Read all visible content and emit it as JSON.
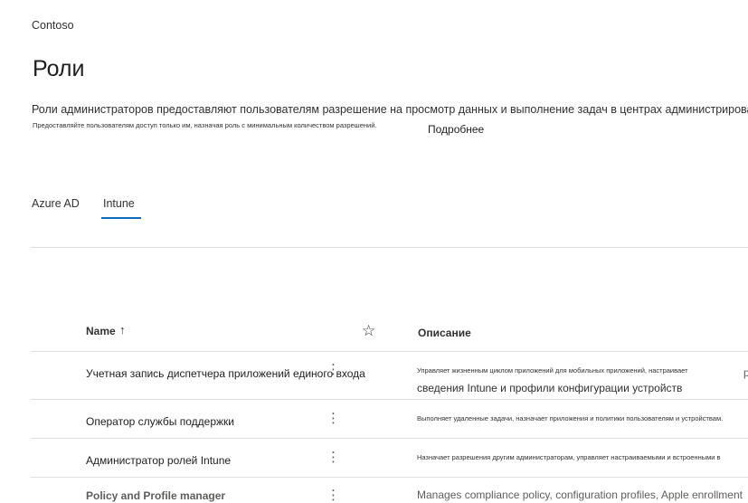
{
  "org_name": "Contoso",
  "page_title": "Роли",
  "description": "Роли администраторов предоставляют пользователям разрешение на просмотр данных и выполнение задач в центрах администрирования.",
  "hint": "Предоставляйте пользователям доступ только им, назначая роль с минимальным количеством разрешений.",
  "learn_more": "Подробнее",
  "tabs": [
    {
      "label": "Azure AD",
      "selected": false
    },
    {
      "label": "Intune",
      "selected": true
    }
  ],
  "table": {
    "col_name": "Name",
    "sort_icon": "↑",
    "favorite_icon": "☆",
    "col_description": "Описание",
    "more_icon": "⋮",
    "rows": [
      {
        "name": "Учетная запись диспетчера приложений единого входа",
        "description_line1": "Управляет жизненным циклом приложений для мобильных приложений, настраивает",
        "description_line2": "сведения Intune и профили конфигурации устройств",
        "overflow": "р"
      },
      {
        "name": "Оператор службы поддержки",
        "description_line1": "Выполняет удаленные задачи, назначает приложения и политики пользователям и устройствам."
      },
      {
        "name": "Администратор ролей Intune",
        "description_line1": "Назначает разрешения другим администраторам, управляет настраиваемыми и встроенными в"
      },
      {
        "name": "Policy and Profile manager",
        "description_line1": "Manages compliance policy, configuration profiles, Apple enrollment"
      }
    ]
  },
  "colors": {
    "accent": "#0f6cbd",
    "divider": "#e1dfdd"
  }
}
